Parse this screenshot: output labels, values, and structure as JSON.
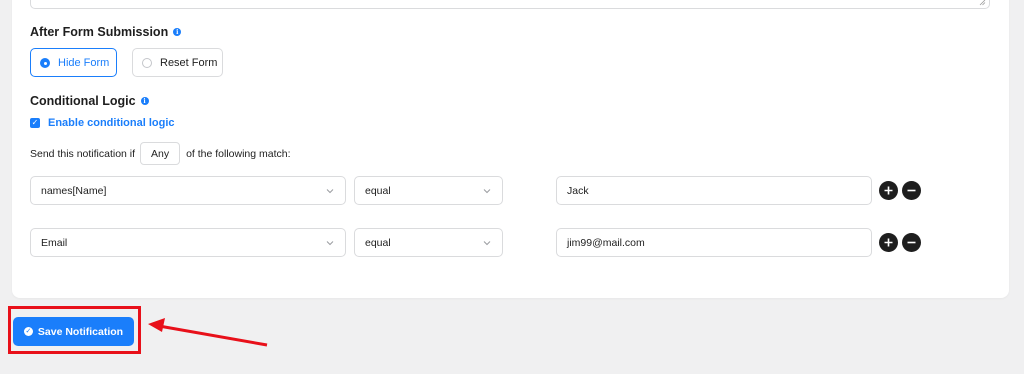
{
  "after_form_submission": {
    "title": "After Form Submission",
    "options": [
      {
        "label": "Hide Form",
        "selected": true
      },
      {
        "label": "Reset Form",
        "selected": false
      }
    ]
  },
  "conditional_logic": {
    "title": "Conditional Logic",
    "enable_label": "Enable conditional logic",
    "enabled": true,
    "match_prefix": "Send this notification if",
    "match_value": "Any",
    "match_suffix": "of the following match:",
    "rules": [
      {
        "field": "names[Name]",
        "operator": "equal",
        "value": "Jack"
      },
      {
        "field": "Email",
        "operator": "equal",
        "value": "jim99@mail.com"
      }
    ]
  },
  "save_button": {
    "label": "Save Notification"
  },
  "colors": {
    "accent": "#1a7efb",
    "highlight": "#e8101a",
    "background": "#f0f0f1",
    "card": "#ffffff"
  },
  "icons": {
    "info": "info-icon",
    "check": "check-icon",
    "chevron": "chevron-down-icon",
    "add": "plus-circle-icon",
    "remove": "minus-circle-icon"
  }
}
